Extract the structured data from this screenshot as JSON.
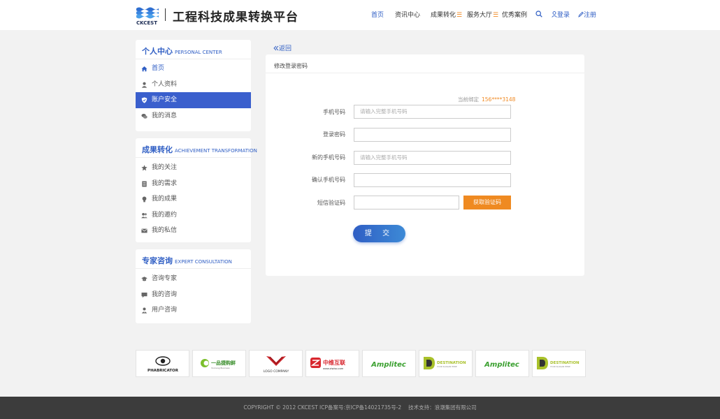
{
  "header": {
    "logo_text": "CKCEST",
    "site_title": "工程科技成果转换平台",
    "nav": [
      {
        "label": "首页",
        "active": true
      },
      {
        "label": "资讯中心"
      },
      {
        "label": "成果转化",
        "menu_icon": "☰"
      },
      {
        "label": "服务大厅",
        "menu_icon": "☰"
      },
      {
        "label": "优秀案例"
      }
    ],
    "login_label": "登录",
    "register_label": "注册"
  },
  "sidebar": {
    "personal": {
      "title": "个人中心",
      "subtitle": "PERSONAL CENTER",
      "items": [
        {
          "label": "首页",
          "icon": "home-icon"
        },
        {
          "label": "个人资料",
          "icon": "user-icon"
        },
        {
          "label": "账户安全",
          "icon": "shield-icon",
          "active": true
        },
        {
          "label": "我的消息",
          "icon": "chat-icon"
        }
      ]
    },
    "achievement": {
      "title": "成果转化",
      "subtitle": "ACHIEVEMENT TRANSFORMATION",
      "items": [
        {
          "label": "我的关注",
          "icon": "star-icon"
        },
        {
          "label": "我的需求",
          "icon": "document-icon"
        },
        {
          "label": "我的成果",
          "icon": "bulb-icon"
        },
        {
          "label": "我的邀约",
          "icon": "users-icon"
        },
        {
          "label": "我的私信",
          "icon": "mail-icon"
        }
      ]
    },
    "expert": {
      "title": "专家咨询",
      "subtitle": "EXPERT CONSULTATION",
      "items": [
        {
          "label": "咨询专家",
          "icon": "graduation-cap-icon"
        },
        {
          "label": "我的咨询",
          "icon": "comment-icon"
        },
        {
          "label": "用户咨询",
          "icon": "user-tie-icon"
        }
      ]
    }
  },
  "main": {
    "back_label": "返回",
    "panel_title": "修改登录密码",
    "bound_label": "当前绑定",
    "bound_phone": "156****3148",
    "form": {
      "phone_label": "手机号码",
      "phone_placeholder": "请输入完整手机号码",
      "password_label": "登录密码",
      "new_phone_label": "新的手机号码",
      "new_phone_placeholder": "请输入完整手机号码",
      "confirm_phone_label": "确认手机号码",
      "sms_label": "短信验证码",
      "get_code_label": "获取验证码",
      "submit_label": "提 交"
    }
  },
  "partners": [
    {
      "name": "PHABRICATOR"
    },
    {
      "name": "一品捷购鲜",
      "sub": "Yonkang Business"
    },
    {
      "name": "LOGO COMPANY"
    },
    {
      "name": "中维互联",
      "sub": "www.ziwiso.com"
    },
    {
      "name": "Amplitec"
    },
    {
      "name": "DESTINATION",
      "sub": "YOUR SLOGAN HERE"
    },
    {
      "name": "Amplitec"
    },
    {
      "name": "DESTINATION",
      "sub": "YOUR SLOGAN HERE"
    }
  ],
  "footer": {
    "copyright": "COPYRIGHT © 2012 CKCEST ICP备案号:京ICP备14021735号-2",
    "support": "技术支持：浪潮集团有限公司"
  },
  "colors": {
    "primary": "#2f5ec4",
    "accent": "#ef8a21",
    "footer_bg": "#3c3c3c"
  }
}
